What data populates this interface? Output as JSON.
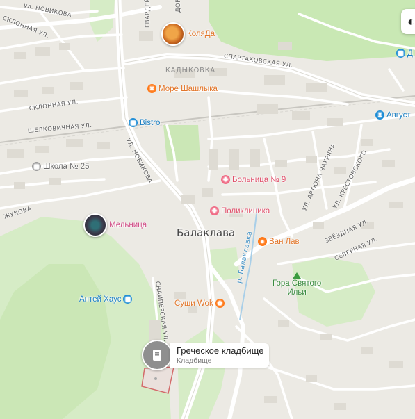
{
  "colors": {
    "land": "#eceae4",
    "road": "#ffffff",
    "park": "#c9e8b4",
    "orange_poi": "#ff7a1a",
    "pink_poi": "#e0506b",
    "blue_poi": "#1b8cd6",
    "gray_poi": "#8f8f8f",
    "green_poi": "#3a9b3f",
    "water_label": "#3d8fc4"
  },
  "streets": {
    "novikova_top": "ул. НОВИКОВА",
    "sklonnaya_top": "СКЛОННАЯ УЛ.",
    "gvardeytsev": "ГВАРДЕЙЦЕВ",
    "dorbotov": "ДОР",
    "spartakovskaya": "СПАРТАКОВСКАЯ УЛ.",
    "sklonnaya": "СКЛОННАЯ УЛ.",
    "shelkovichnaya": "ШЕЛКОВИЧНАЯ УЛ.",
    "novikova_mid": "УЛ. НОВИКОВА",
    "zhukova": "ЖУКОВА",
    "kresstovskogo": "УЛ. КРЕСТОВСКОГО",
    "chakhryana": "УЛ. АРТЮНА ЧАХРЯНА",
    "zvyozdnaya": "ЗВЁЗДНАЯ УЛ.",
    "severnaya": "СЕВЕРНАЯ УЛ.",
    "snayperskaya": "СНАЙПЕРСКАЯ УЛ.",
    "balaklavka": "р. Балаклавка"
  },
  "districts": {
    "kadykovka": "КАДЫКОВКА"
  },
  "town": "Балаклава",
  "pois": {
    "kolyada": "КоляДа",
    "more_shashlyka": "Море Шашлыка",
    "bistro": "Bistro",
    "avgust": "Август",
    "shkola": "Школа № 25",
    "bolnitsa": "Больница № 9",
    "poliklinika": "Поликлиника",
    "melnitsa": "Мельница",
    "van_lav": "Ван Лав",
    "antey": "Антей Хаус",
    "sushi": "Суши Wok",
    "gora_line1": "Гора Святого",
    "gora_line2": "Ильи",
    "edge_d": "Д"
  },
  "callout": {
    "title": "Греческое кладбище",
    "subtitle": "Кладбище"
  },
  "icons": {
    "top_control": "layers-icon",
    "cemetery": "cemetery-icon"
  }
}
